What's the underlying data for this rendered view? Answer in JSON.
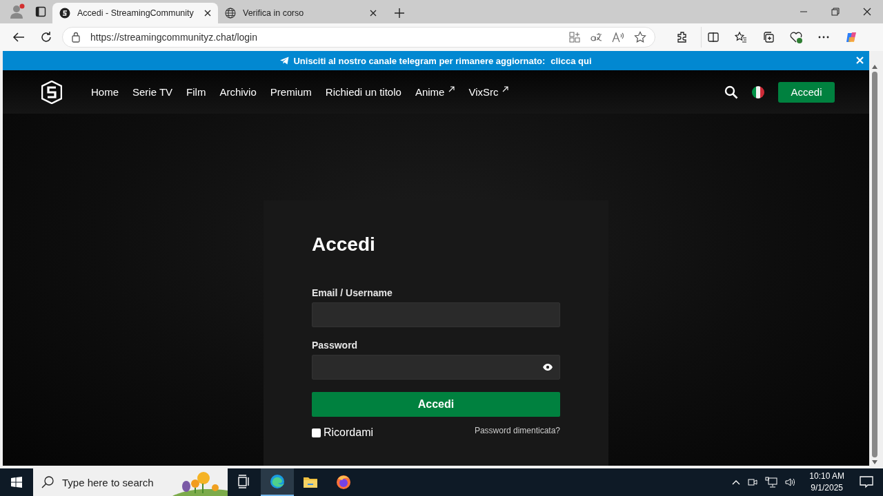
{
  "browser": {
    "tabs": [
      {
        "title": "Accedi - StreamingCommunity",
        "selected": true,
        "kind": "site"
      },
      {
        "title": "Verifica in corso",
        "selected": false,
        "kind": "globe"
      }
    ],
    "url": "https://streamingcommunityz.chat/login"
  },
  "banner": {
    "text": "Unisciti al nostro canale telegram per rimanere aggiornato:",
    "link": "clicca qui"
  },
  "nav": {
    "items": [
      {
        "label": "Home",
        "external": false
      },
      {
        "label": "Serie TV",
        "external": false
      },
      {
        "label": "Film",
        "external": false
      },
      {
        "label": "Archivio",
        "external": false
      },
      {
        "label": "Premium",
        "external": false
      },
      {
        "label": "Richiedi un titolo",
        "external": false
      },
      {
        "label": "Anime",
        "external": true
      },
      {
        "label": "VixSrc",
        "external": true
      }
    ],
    "login": "Accedi"
  },
  "login": {
    "title": "Accedi",
    "fields": [
      {
        "label": "Email / Username",
        "kind": "text"
      },
      {
        "label": "Password",
        "kind": "password"
      }
    ],
    "submit": "Accedi",
    "remember": {
      "label": "Ricordami",
      "checked": false
    },
    "forgot": "Password dimenticata?"
  },
  "taskbar": {
    "search_placeholder": "Type here to search",
    "time": "10:10 AM",
    "date": "9/1/2025"
  }
}
